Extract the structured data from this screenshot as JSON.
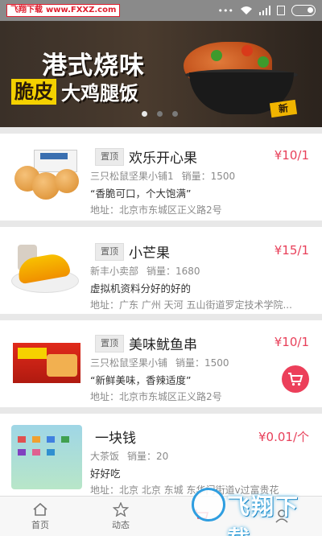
{
  "status_bar": {
    "watermark_title": "飞翔下载",
    "watermark_url": "www.FXXZ.com"
  },
  "banner": {
    "line1": "港式烧味",
    "line2_highlight": "脆皮",
    "line2_rest": "大鸡腿饭",
    "badge": "新",
    "slide_count": 3,
    "active_slide": 1
  },
  "products": [
    {
      "tag": "置顶",
      "name": "欢乐开心果",
      "price": "¥10/1",
      "shop": "三只松鼠坚果小铺1",
      "sales_label": "销量：",
      "sales": "1500",
      "description": "“香脆可口，个大饱满”",
      "address": "地址：北京市东城区正义路2号",
      "show_cart": false
    },
    {
      "tag": "置顶",
      "name": "小芒果",
      "price": "¥15/1",
      "shop": "新丰小卖部",
      "sales_label": "销量：",
      "sales": "1680",
      "description": "虚拟机资料分好的好的",
      "address": "地址：广东 广州 天河 五山街道罗定技术学院...",
      "show_cart": false
    },
    {
      "tag": "置顶",
      "name": "美味鱿鱼串",
      "price": "¥10/1",
      "shop": "三只松鼠坚果小铺",
      "sales_label": "销量：",
      "sales": "1500",
      "description": "“新鲜美味，香辣适度”",
      "address": "地址：北京市东城区正义路2号",
      "show_cart": true
    },
    {
      "tag": "",
      "name": "一块钱",
      "price": "¥0.01/个",
      "shop": "大茶饭",
      "sales_label": "销量：",
      "sales": "20",
      "description": "好好吃",
      "address": "地址：北京 北京 东城 东华门街道v过富贵花",
      "show_cart": false
    }
  ],
  "bottom_nav": [
    {
      "label": "首页",
      "icon": "home-icon"
    },
    {
      "label": "动态",
      "icon": "star-icon"
    },
    {
      "label": "",
      "icon": "cart-icon"
    },
    {
      "label": "",
      "icon": "user-icon"
    }
  ],
  "overlay_watermark": {
    "title": "飞翔下载"
  },
  "colors": {
    "accent": "#e8405a",
    "status_bar": "#8a8a8a"
  }
}
